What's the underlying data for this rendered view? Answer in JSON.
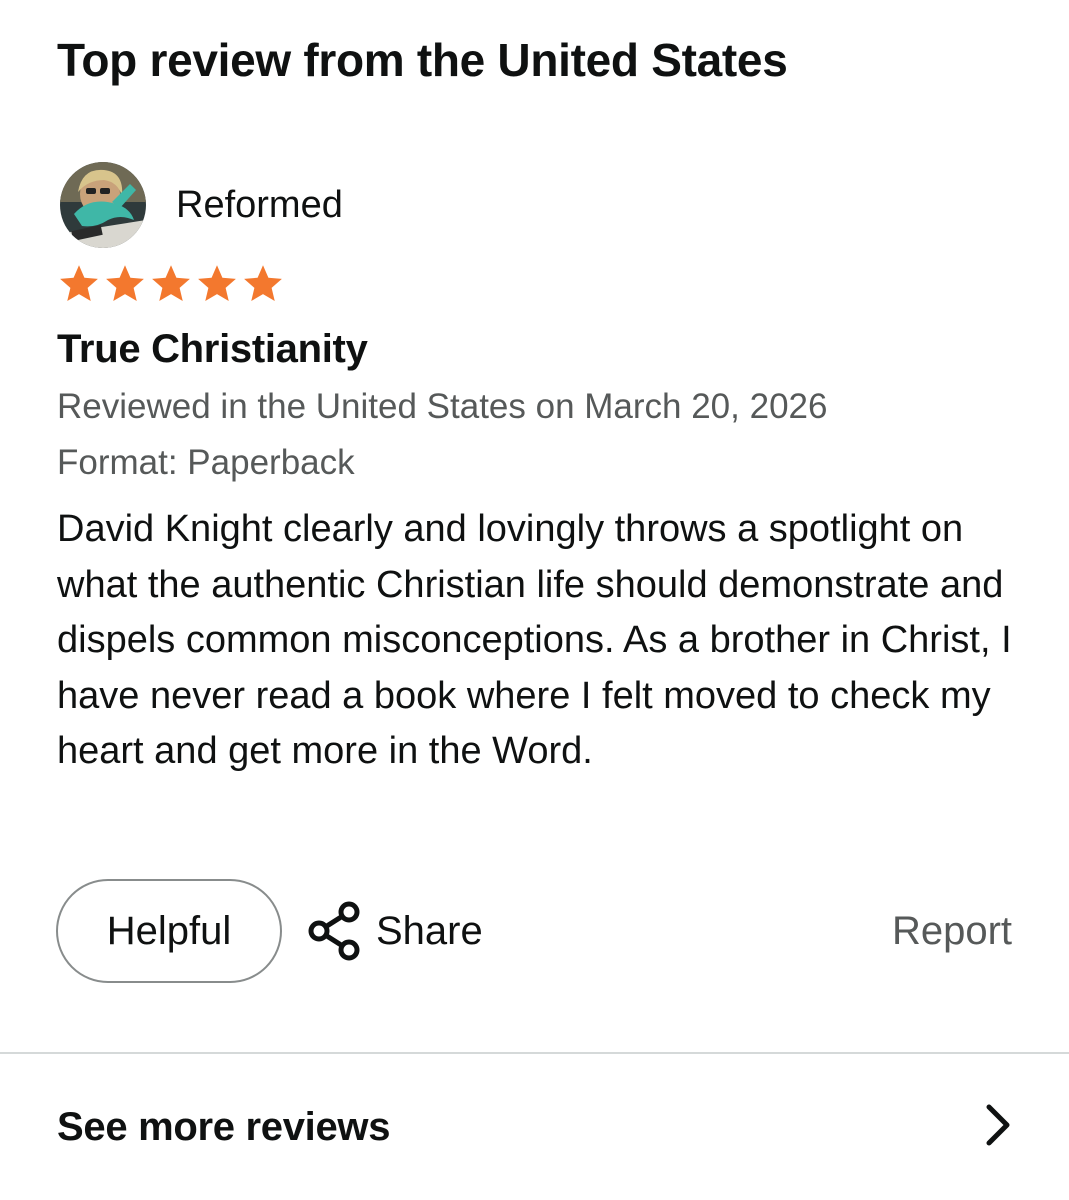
{
  "section": {
    "title": "Top review from the United States"
  },
  "review": {
    "reviewer_name": "Reformed",
    "rating": 5,
    "rating_max": 5,
    "star_color": "#f3782e",
    "title": "True Christianity",
    "date_line": "Reviewed in the United States on March 20, 2026",
    "format_line": "Format: Paperback",
    "body": "David Knight clearly and lovingly throws a spotlight on what the authentic Christian life should demonstrate and dispels common misconceptions. As a brother in Christ, I have never read a book where I felt moved to check my heart and get more in the Word."
  },
  "actions": {
    "helpful_label": "Helpful",
    "share_label": "Share",
    "share_icon": "share-icon",
    "report_label": "Report"
  },
  "footer": {
    "see_more_label": "See more reviews",
    "chevron_icon": "chevron-right-icon"
  }
}
